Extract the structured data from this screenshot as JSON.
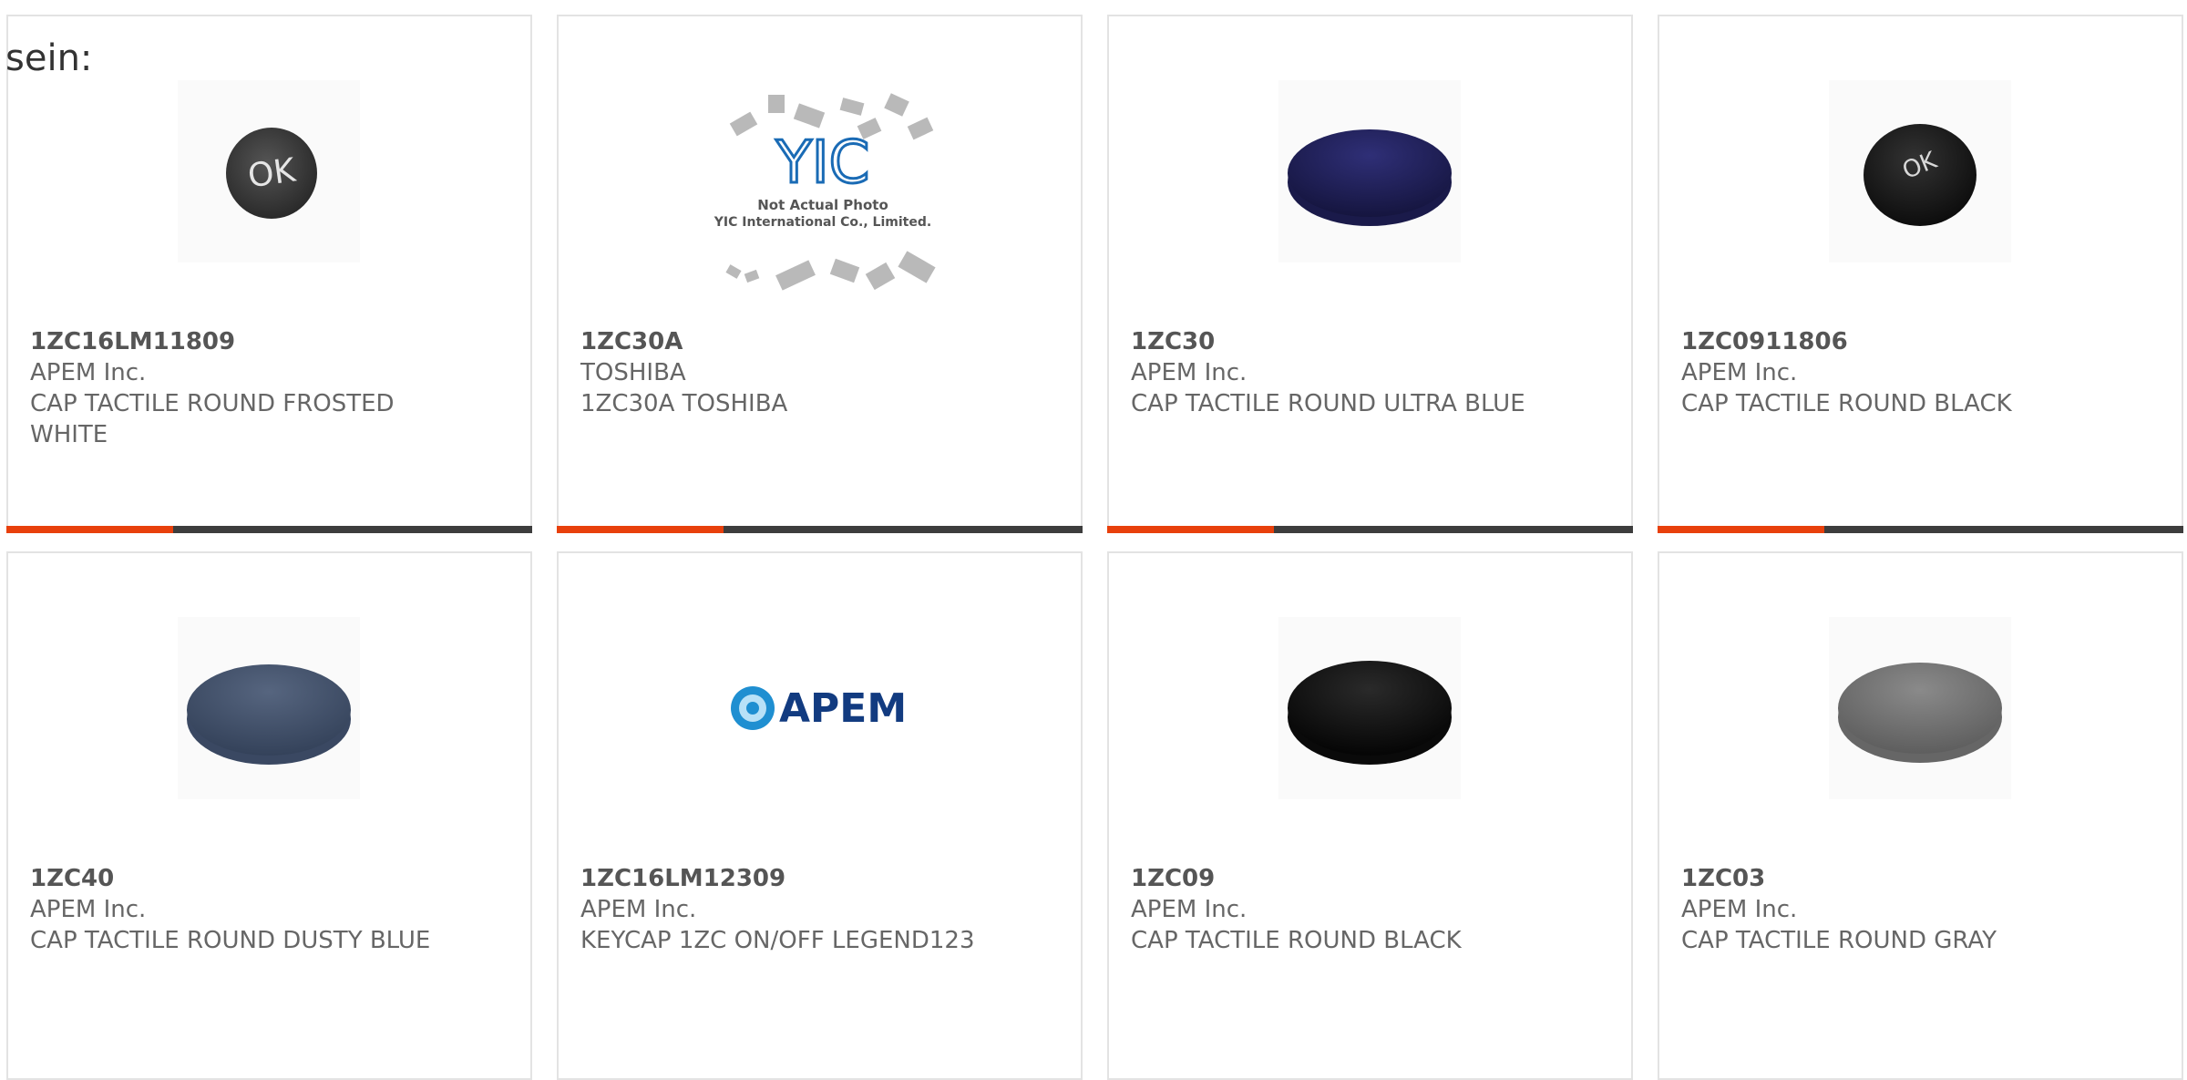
{
  "intro_text": "sein:",
  "colors": {
    "accent": "#e8400c",
    "bar_dark": "#3d3d3d",
    "border": "#e3e3e3",
    "text": "#666666"
  },
  "products": [
    {
      "part_number": "1ZC16LM11809",
      "manufacturer": "APEM Inc.",
      "description": "CAP TACTILE ROUND FROSTED WHITE",
      "image": "ok-cap-dark-gray"
    },
    {
      "part_number": "1ZC30A",
      "manufacturer": "TOSHIBA",
      "description": "1ZC30A TOSHIBA",
      "image": "yic-placeholder",
      "image_text": {
        "logo": "YIC",
        "line1": "Not Actual Photo",
        "line2": "YIC International Co., Limited."
      }
    },
    {
      "part_number": "1ZC30",
      "manufacturer": "APEM Inc.",
      "description": "CAP TACTILE ROUND ULTRA BLUE",
      "image": "cap-navy"
    },
    {
      "part_number": "1ZC0911806",
      "manufacturer": "APEM Inc.",
      "description": "CAP TACTILE ROUND BLACK",
      "image": "ok-cap-black"
    },
    {
      "part_number": "1ZC40",
      "manufacturer": "APEM Inc.",
      "description": "CAP TACTILE ROUND DUSTY BLUE",
      "image": "cap-dusty-blue"
    },
    {
      "part_number": "1ZC16LM12309",
      "manufacturer": "APEM Inc.",
      "description": "KEYCAP 1ZC ON/OFF LEGEND123",
      "image": "apem-logo",
      "image_text": {
        "logo": "APEM"
      }
    },
    {
      "part_number": "1ZC09",
      "manufacturer": "APEM Inc.",
      "description": "CAP TACTILE ROUND BLACK",
      "image": "cap-black"
    },
    {
      "part_number": "1ZC03",
      "manufacturer": "APEM Inc.",
      "description": "CAP TACTILE ROUND GRAY",
      "image": "cap-gray"
    }
  ]
}
